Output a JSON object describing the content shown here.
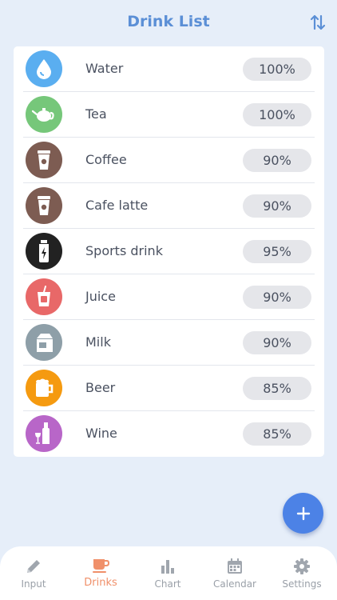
{
  "header": {
    "title": "Drink List",
    "sort_icon": "sort-arrows-icon"
  },
  "drinks": [
    {
      "name": "Water",
      "pct": "100%",
      "icon": "water-drop-icon",
      "color": "#5aaef0"
    },
    {
      "name": "Tea",
      "pct": "100%",
      "icon": "teapot-icon",
      "color": "#76c77a"
    },
    {
      "name": "Coffee",
      "pct": "90%",
      "icon": "coffee-cup-icon",
      "color": "#7d5c52"
    },
    {
      "name": "Cafe latte",
      "pct": "90%",
      "icon": "latte-cup-icon",
      "color": "#7d5c52"
    },
    {
      "name": "Sports drink",
      "pct": "95%",
      "icon": "sports-bottle-icon",
      "color": "#222222"
    },
    {
      "name": "Juice",
      "pct": "90%",
      "icon": "juice-glass-icon",
      "color": "#e86868"
    },
    {
      "name": "Milk",
      "pct": "90%",
      "icon": "milk-carton-icon",
      "color": "#8e9fa8"
    },
    {
      "name": "Beer",
      "pct": "85%",
      "icon": "beer-mug-icon",
      "color": "#f59a10"
    },
    {
      "name": "Wine",
      "pct": "85%",
      "icon": "wine-bottle-icon",
      "color": "#b866c8"
    }
  ],
  "fab": {
    "icon": "plus-icon",
    "color": "#4c82e6"
  },
  "tabs": [
    {
      "label": "Input",
      "icon": "pencil-icon",
      "active": false
    },
    {
      "label": "Drinks",
      "icon": "cup-icon",
      "active": true
    },
    {
      "label": "Chart",
      "icon": "bar-chart-icon",
      "active": false
    },
    {
      "label": "Calendar",
      "icon": "calendar-icon",
      "active": false
    },
    {
      "label": "Settings",
      "icon": "gear-icon",
      "active": false
    }
  ],
  "colors": {
    "accent": "#5b8fd6",
    "active_tab": "#f0906a",
    "inactive_tab": "#9aa0a8",
    "background": "#e6eef9"
  }
}
